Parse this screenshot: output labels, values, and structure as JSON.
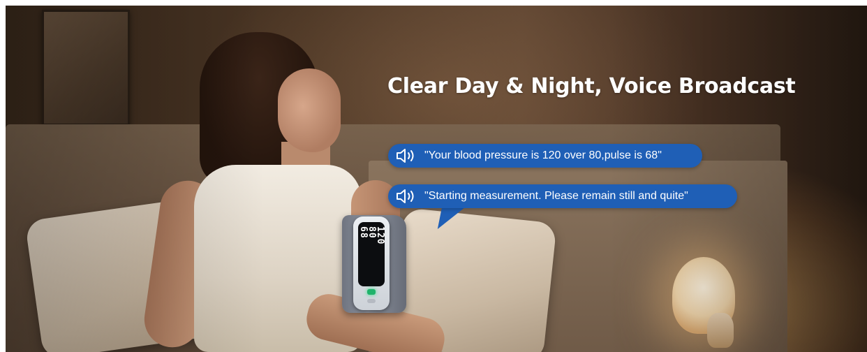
{
  "banner": {
    "headline": "Clear Day & Night, Voice Broadcast",
    "bubbles": [
      {
        "icon": "speaker-icon",
        "text": "\"Your blood pressure is 120 over 80,pulse is 68\""
      },
      {
        "icon": "speaker-icon",
        "text": "\"Starting measurement. Please remain still and quite\""
      }
    ],
    "bubble_color": "#1f5fb6",
    "text_color": "#ffffff",
    "monitor": {
      "systolic": "120",
      "diastolic": "80",
      "pulse": "68"
    }
  }
}
